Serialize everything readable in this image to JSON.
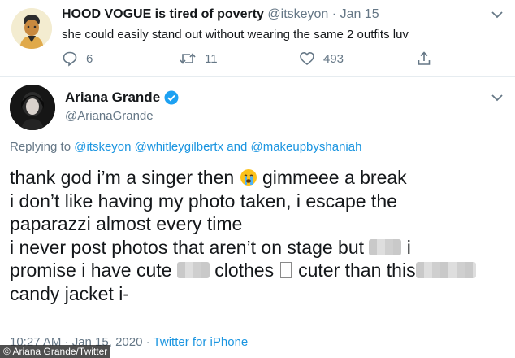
{
  "top_tweet": {
    "display_name": "HOOD VOGUE is tired of poverty",
    "handle": "@itskeyon",
    "separator": "·",
    "date": "Jan 15",
    "text": "she could easily stand out without wearing the same 2 outfits luv",
    "replies": "6",
    "retweets": "11",
    "likes": "493"
  },
  "main_tweet": {
    "display_name": "Ariana Grande",
    "handle": "@ArianaGrande",
    "replying_label": "Replying to",
    "mentions": [
      "@itskeyon",
      "@whitleygilbertx",
      "and",
      "@makeupbyshaniah"
    ],
    "lines": {
      "l1a": "thank god i’m a singer then",
      "l1b": "gimmeee a break",
      "l2": "i don’t like having my photo taken, i escape the",
      "l3": "paparazzi almost every time",
      "l4a": "i never post photos that aren’t on stage but",
      "l4b": "i",
      "l5a": "promise i have cute",
      "l5b": "clothes",
      "l5c": "cuter than this",
      "l6": "candy jacket i-"
    },
    "timestamp": "10:27 AM · Jan 15, 2020 ·",
    "source": "Twitter for iPhone"
  },
  "credit": "© Ariana Grande/Twitter",
  "icons": {
    "reply": "reply-icon",
    "retweet": "retweet-icon",
    "like": "heart-icon",
    "share": "share-icon",
    "verified": "verified-badge-icon",
    "menu": "chevron-down-icon"
  },
  "colors": {
    "link": "#1b95e0",
    "muted": "#657786",
    "text": "#14171a",
    "verified": "#1da1f2"
  }
}
